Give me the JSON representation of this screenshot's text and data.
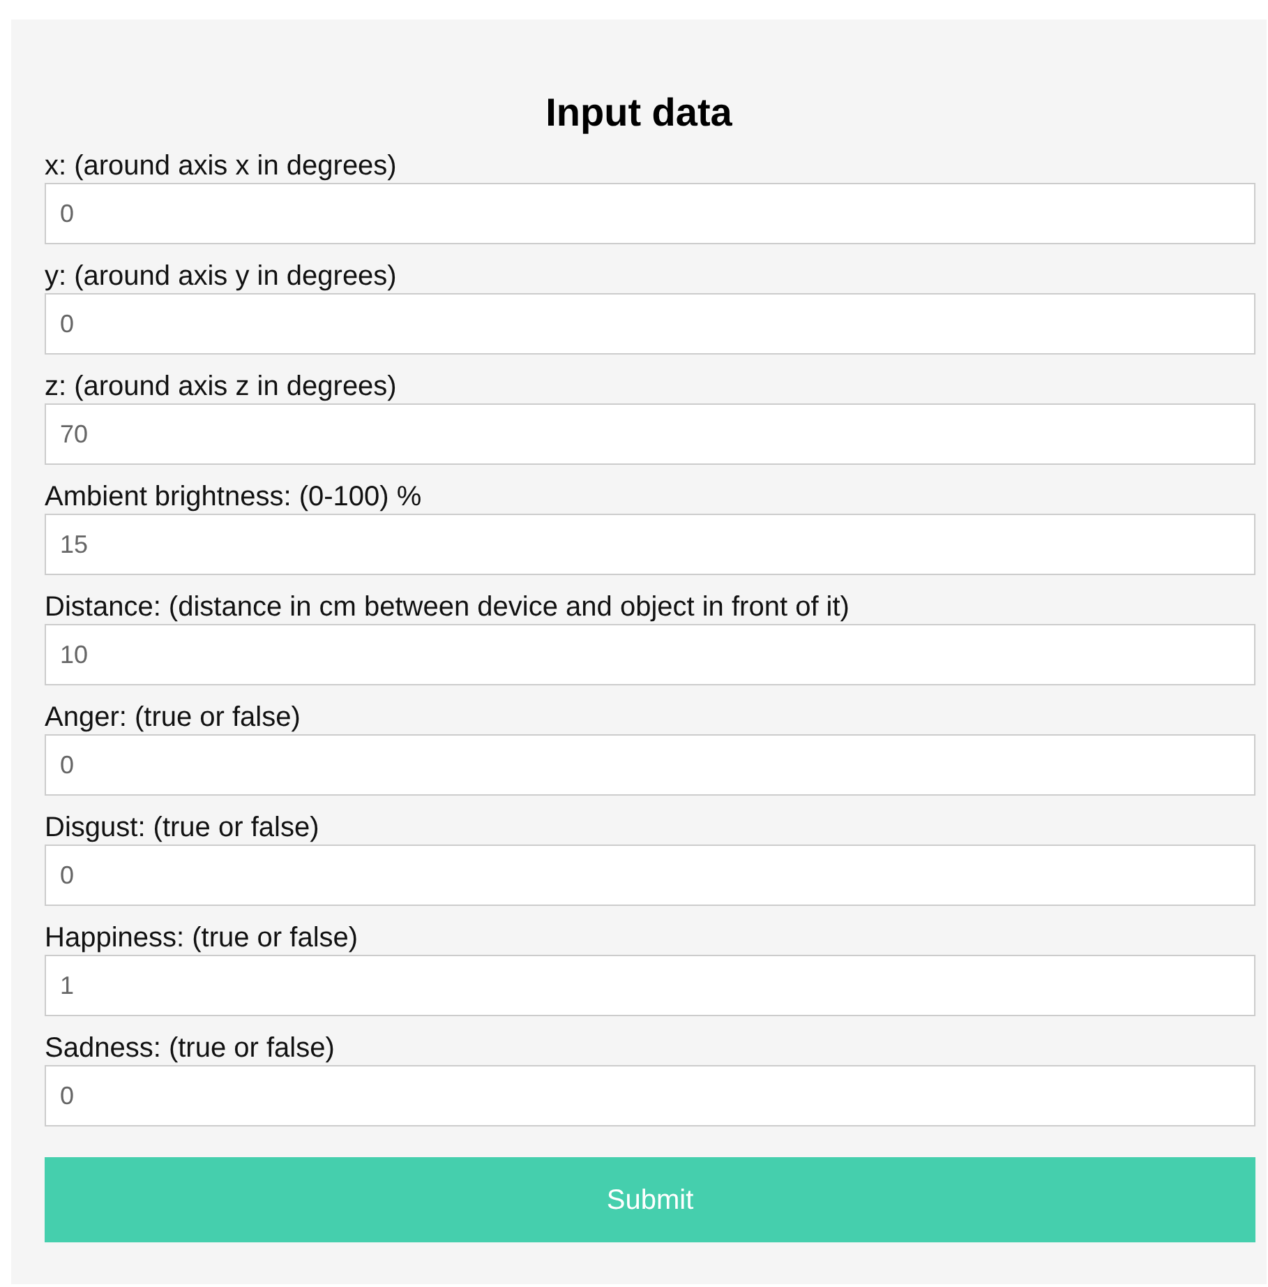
{
  "title": "Input data",
  "fields": [
    {
      "label": "x: (around axis x in degrees)",
      "value": "0"
    },
    {
      "label": "y: (around axis y in degrees)",
      "value": "0"
    },
    {
      "label": "z: (around axis z in degrees)",
      "value": "70"
    },
    {
      "label": "Ambient brightness: (0-100) %",
      "value": "15"
    },
    {
      "label": "Distance: (distance in cm between device and object in front of it)",
      "value": "10"
    },
    {
      "label": "Anger: (true or false)",
      "value": "0"
    },
    {
      "label": "Disgust: (true or false)",
      "value": "0"
    },
    {
      "label": "Happiness: (true or false)",
      "value": "1"
    },
    {
      "label": "Sadness: (true or false)",
      "value": "0"
    }
  ],
  "submit": "Submit"
}
